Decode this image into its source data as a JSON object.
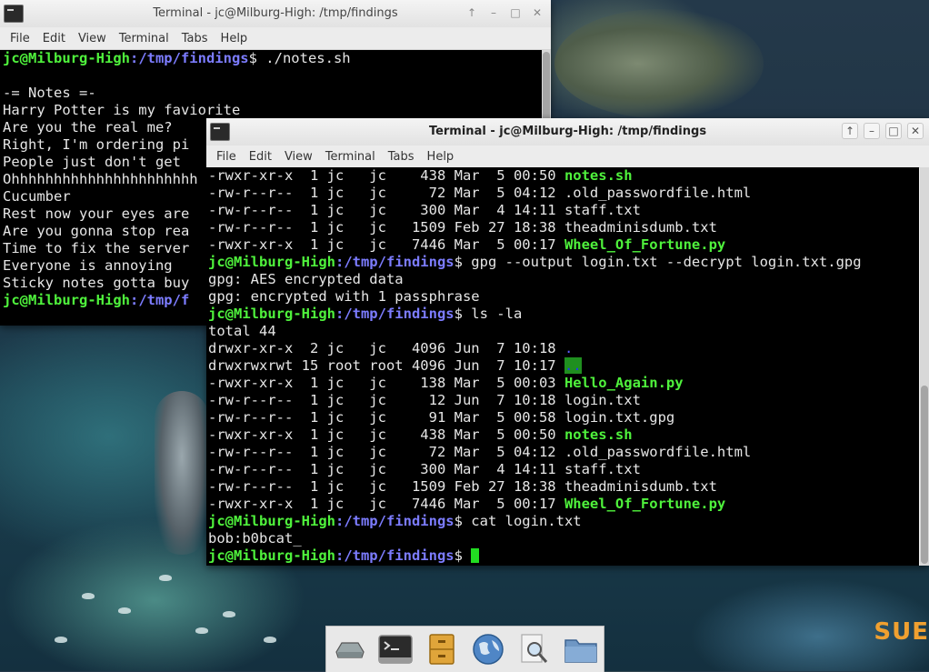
{
  "desktop": {
    "corner_text": "SUE"
  },
  "back_window": {
    "title": "Terminal - jc@Milburg-High: /tmp/findings",
    "menu": [
      "File",
      "Edit",
      "View",
      "Terminal",
      "Tabs",
      "Help"
    ],
    "prompt_user": "jc@Milburg-High",
    "prompt_path": ":/tmp/findings",
    "command": "$ ./notes.sh",
    "output": [
      "",
      "-= Notes =-",
      "Harry Potter is my faviorite",
      "Are you the real me?",
      "Right, I'm ordering pi",
      "People just don't get",
      "Ohhhhhhhhhhhhhhhhhhhhhh",
      "Cucumber",
      "Rest now your eyes are",
      "Are you gonna stop rea",
      "Time to fix the server",
      "Everyone is annoying",
      "Sticky notes gotta buy"
    ],
    "last_prompt_path": ":/tmp/f"
  },
  "front_window": {
    "title": "Terminal - jc@Milburg-High: /tmp/findings",
    "menu": [
      "File",
      "Edit",
      "View",
      "Terminal",
      "Tabs",
      "Help"
    ],
    "lines": [
      {
        "kind": "file",
        "text": "-rwxr-xr-x  1 jc   jc    438 Mar  5 00:50 ",
        "name": "notes.sh",
        "style": "exec"
      },
      {
        "kind": "file",
        "text": "-rw-r--r--  1 jc   jc     72 Mar  5 04:12 ",
        "name": ".old_passwordfile.html",
        "style": "plain"
      },
      {
        "kind": "file",
        "text": "-rw-r--r--  1 jc   jc    300 Mar  4 14:11 ",
        "name": "staff.txt",
        "style": "plain"
      },
      {
        "kind": "file",
        "text": "-rw-r--r--  1 jc   jc   1509 Feb 27 18:38 ",
        "name": "theadminisdumb.txt",
        "style": "plain"
      },
      {
        "kind": "file",
        "text": "-rwxr-xr-x  1 jc   jc   7446 Mar  5 00:17 ",
        "name": "Wheel_Of_Fortune.py",
        "style": "exec"
      },
      {
        "kind": "prompt",
        "user": "jc@Milburg-High",
        "path": ":/tmp/findings",
        "cmd": "$ gpg --output login.txt --decrypt login.txt.gpg"
      },
      {
        "kind": "text",
        "text": "gpg: AES encrypted data"
      },
      {
        "kind": "text",
        "text": "gpg: encrypted with 1 passphrase"
      },
      {
        "kind": "prompt",
        "user": "jc@Milburg-High",
        "path": ":/tmp/findings",
        "cmd": "$ ls -la"
      },
      {
        "kind": "text",
        "text": "total 44"
      },
      {
        "kind": "file",
        "text": "drwxr-xr-x  2 jc   jc   4096 Jun  7 10:18 ",
        "name": ".",
        "style": "dir"
      },
      {
        "kind": "file",
        "text": "drwxrwxrwt 15 root root 4096 Jun  7 10:17 ",
        "name": "..",
        "style": "dirhl"
      },
      {
        "kind": "file",
        "text": "-rwxr-xr-x  1 jc   jc    138 Mar  5 00:03 ",
        "name": "Hello_Again.py",
        "style": "exec"
      },
      {
        "kind": "file",
        "text": "-rw-r--r--  1 jc   jc     12 Jun  7 10:18 ",
        "name": "login.txt",
        "style": "plain"
      },
      {
        "kind": "file",
        "text": "-rw-r--r--  1 jc   jc     91 Mar  5 00:58 ",
        "name": "login.txt.gpg",
        "style": "plain"
      },
      {
        "kind": "file",
        "text": "-rwxr-xr-x  1 jc   jc    438 Mar  5 00:50 ",
        "name": "notes.sh",
        "style": "exec"
      },
      {
        "kind": "file",
        "text": "-rw-r--r--  1 jc   jc     72 Mar  5 04:12 ",
        "name": ".old_passwordfile.html",
        "style": "plain"
      },
      {
        "kind": "file",
        "text": "-rw-r--r--  1 jc   jc    300 Mar  4 14:11 ",
        "name": "staff.txt",
        "style": "plain"
      },
      {
        "kind": "file",
        "text": "-rw-r--r--  1 jc   jc   1509 Feb 27 18:38 ",
        "name": "theadminisdumb.txt",
        "style": "plain"
      },
      {
        "kind": "file",
        "text": "-rwxr-xr-x  1 jc   jc   7446 Mar  5 00:17 ",
        "name": "Wheel_Of_Fortune.py",
        "style": "exec"
      },
      {
        "kind": "prompt",
        "user": "jc@Milburg-High",
        "path": ":/tmp/findings",
        "cmd": "$ cat login.txt"
      },
      {
        "kind": "text",
        "text": "bob:b0bcat_"
      },
      {
        "kind": "prompt",
        "user": "jc@Milburg-High",
        "path": ":/tmp/findings",
        "cmd": "$ ",
        "cursor": true
      }
    ]
  },
  "dock": {
    "apps": [
      {
        "name": "drive-icon"
      },
      {
        "name": "terminal-icon"
      },
      {
        "name": "file-cabinet-icon"
      },
      {
        "name": "web-browser-icon"
      },
      {
        "name": "search-icon"
      },
      {
        "name": "folder-icon"
      }
    ]
  },
  "colors": {
    "prompt_user": "#4ff23c",
    "prompt_path": "#7c7cff",
    "exec": "#4ff23c",
    "terminal_bg": "#000000"
  }
}
